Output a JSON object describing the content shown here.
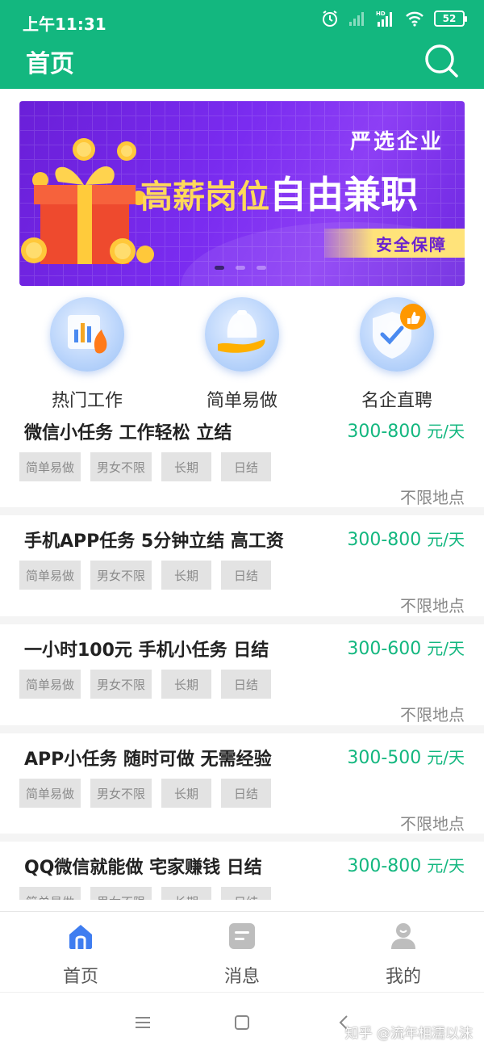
{
  "status_bar": {
    "time": "上午11:31",
    "battery": "52"
  },
  "header": {
    "title": "首页"
  },
  "banner": {
    "subtitle": "严选企业",
    "headline_part1": "高薪岗位",
    "headline_part2": "自由兼职",
    "tag": "安全保障"
  },
  "categories": [
    {
      "label": "热门工作",
      "icon": "chart-icon"
    },
    {
      "label": "简单易做",
      "icon": "helping-hand-icon"
    },
    {
      "label": "名企直聘",
      "icon": "shield-thumbs-up-icon"
    }
  ],
  "jobs": [
    {
      "title": "微信小任务 工作轻松 立结",
      "pay": "300-800",
      "unit": "元/天",
      "tags": [
        "简单易做",
        "男女不限",
        "长期",
        "日结"
      ],
      "location": "不限地点"
    },
    {
      "title": "手机APP任务 5分钟立结 高工资",
      "pay": "300-800",
      "unit": "元/天",
      "tags": [
        "简单易做",
        "男女不限",
        "长期",
        "日结"
      ],
      "location": "不限地点"
    },
    {
      "title": "一小时100元 手机小任务 日结",
      "pay": "300-600",
      "unit": "元/天",
      "tags": [
        "简单易做",
        "男女不限",
        "长期",
        "日结"
      ],
      "location": "不限地点"
    },
    {
      "title": "APP小任务 随时可做 无需经验",
      "pay": "300-500",
      "unit": "元/天",
      "tags": [
        "简单易做",
        "男女不限",
        "长期",
        "日结"
      ],
      "location": "不限地点"
    },
    {
      "title": "QQ微信就能做 宅家赚钱 日结",
      "pay": "300-800",
      "unit": "元/天",
      "tags": [
        "简单易做",
        "男女不限",
        "长期",
        "日结"
      ],
      "location": ""
    }
  ],
  "bottom_nav": [
    {
      "label": "首页",
      "icon": "home-icon",
      "active": true
    },
    {
      "label": "消息",
      "icon": "message-icon",
      "active": false
    },
    {
      "label": "我的",
      "icon": "user-icon",
      "active": false
    }
  ],
  "watermark": "知乎 @流年相濡以沫",
  "colors": {
    "primary": "#13b77f",
    "banner": "#7a2cf0",
    "tag_bg": "#e3e3e3",
    "nav_active": "#3f7df0",
    "nav_inactive": "#bdbdbd"
  }
}
